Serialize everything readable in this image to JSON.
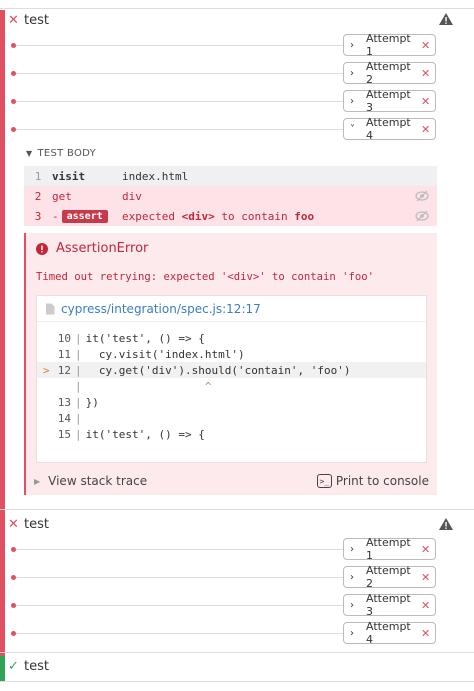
{
  "tests": [
    {
      "title": "test",
      "status": "failed"
    },
    {
      "title": "test",
      "status": "failed"
    },
    {
      "title": "test",
      "status": "passed"
    }
  ],
  "attempts_block1": [
    {
      "label": "Attempt 1",
      "chevron": "›"
    },
    {
      "label": "Attempt 2",
      "chevron": "›"
    },
    {
      "label": "Attempt 3",
      "chevron": "›"
    },
    {
      "label": "Attempt 4",
      "chevron": "˅"
    }
  ],
  "attempts_block2": [
    {
      "label": "Attempt 1",
      "chevron": "›"
    },
    {
      "label": "Attempt 2",
      "chevron": "›"
    },
    {
      "label": "Attempt 3",
      "chevron": "›"
    },
    {
      "label": "Attempt 4",
      "chevron": "›"
    }
  ],
  "test_body_label": "TEST BODY",
  "commands": [
    {
      "num": "1",
      "name": "visit",
      "message": "index.html"
    },
    {
      "num": "2",
      "name": "get",
      "message": "div"
    },
    {
      "num": "3",
      "name": "assert",
      "message_pre": "expected ",
      "m1": "<div>",
      "m2": " to contain ",
      "m3": "foo"
    }
  ],
  "error": {
    "title": "AssertionError",
    "message": "Timed out retrying: expected '<div>' to contain 'foo'",
    "file": "cypress/integration/spec.js:12:17",
    "code": [
      {
        "ln": "10",
        "marker": "",
        "text": "it('test', () => {"
      },
      {
        "ln": "11",
        "marker": "",
        "text": "  cy.visit('index.html')"
      },
      {
        "ln": "12",
        "marker": ">",
        "text": "  cy.get('div').should('contain', 'foo')"
      },
      {
        "ln": "",
        "marker": "",
        "text": "                  ^"
      },
      {
        "ln": "13",
        "marker": "",
        "text": "})"
      },
      {
        "ln": "14",
        "marker": "",
        "text": ""
      },
      {
        "ln": "15",
        "marker": "",
        "text": "it('test', () => {"
      }
    ],
    "view_stack": "View stack trace",
    "print_console": "Print to console"
  },
  "colors": {
    "fail": "#e05061",
    "pass": "#31a354",
    "link": "#3a7ec4"
  }
}
